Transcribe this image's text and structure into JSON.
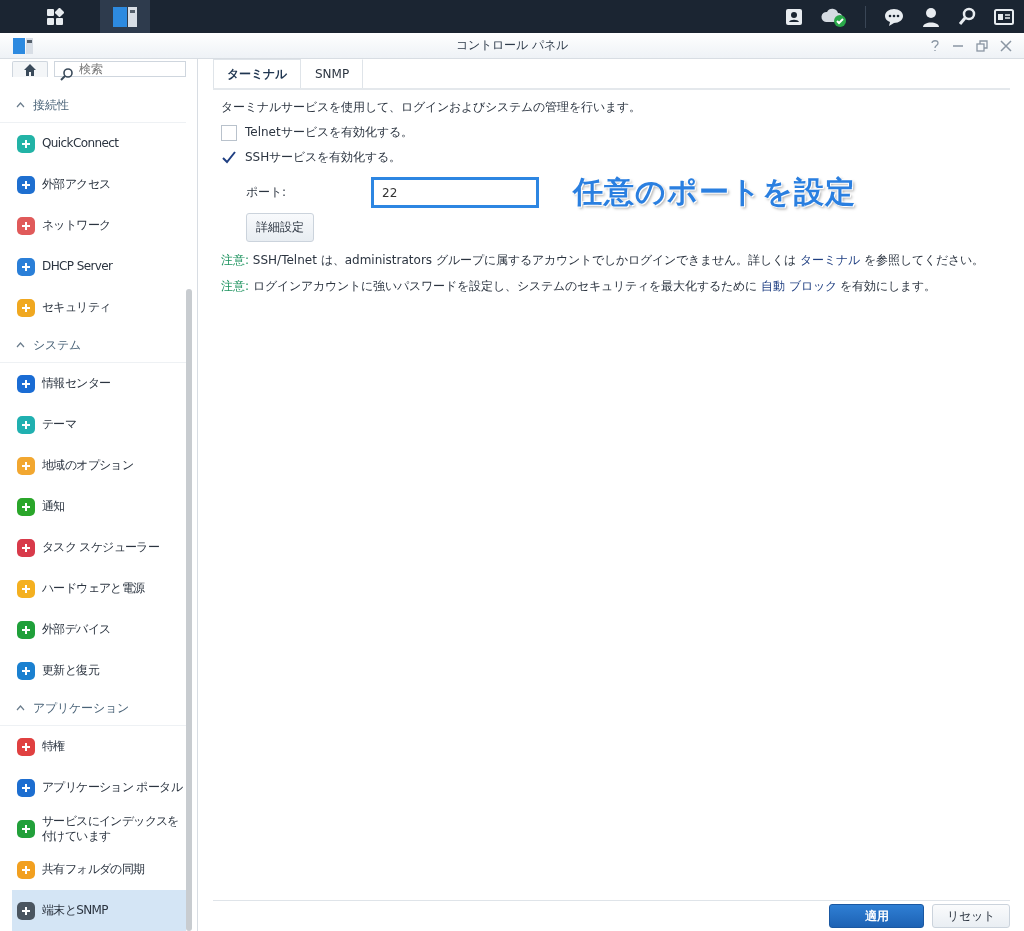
{
  "taskbar": {
    "apps": [
      {
        "selected": false
      },
      {
        "selected": true
      }
    ]
  },
  "window": {
    "title": "コントロール パネル"
  },
  "sidebar": {
    "search": {
      "placeholder": "検索"
    },
    "items": [
      {
        "kind": "section",
        "label": "接続性",
        "expanded": true
      },
      {
        "kind": "item",
        "label": "QuickConnect",
        "color": "#22b3a6",
        "selected": false
      },
      {
        "kind": "item",
        "label": "外部アクセス",
        "color": "#1e6fd0",
        "selected": false
      },
      {
        "kind": "item",
        "label": "ネットワーク",
        "color": "#e05a5a",
        "selected": false
      },
      {
        "kind": "item",
        "label": "DHCP Server",
        "color": "#2a7fd8",
        "selected": false
      },
      {
        "kind": "item",
        "label": "セキュリティ",
        "color": "#f0a820",
        "selected": false
      },
      {
        "kind": "section",
        "label": "システム",
        "expanded": true
      },
      {
        "kind": "item",
        "label": "情報センター",
        "color": "#1a6cd4",
        "selected": false
      },
      {
        "kind": "item",
        "label": "テーマ",
        "color": "#20b0b0",
        "selected": false
      },
      {
        "kind": "item",
        "label": "地域のオプション",
        "color": "#f2a730",
        "selected": false
      },
      {
        "kind": "item",
        "label": "通知",
        "color": "#2aa62a",
        "selected": false
      },
      {
        "kind": "item",
        "label": "タスク スケジューラー",
        "color": "#d83a4a",
        "selected": false
      },
      {
        "kind": "item",
        "label": "ハードウェアと電源",
        "color": "#f4b020",
        "selected": false
      },
      {
        "kind": "item",
        "label": "外部デバイス",
        "color": "#1fa03a",
        "selected": false
      },
      {
        "kind": "item",
        "label": "更新と復元",
        "color": "#1a80d0",
        "selected": false
      },
      {
        "kind": "section",
        "label": "アプリケーション",
        "expanded": true
      },
      {
        "kind": "item",
        "label": "特権",
        "color": "#e04040",
        "selected": false
      },
      {
        "kind": "item",
        "label": "アプリケーション ポータル",
        "color": "#1d6ed0",
        "selected": false
      },
      {
        "kind": "item",
        "label": "サービスにインデックスを付けています",
        "color": "#22a03a",
        "selected": false
      },
      {
        "kind": "item",
        "label": "共有フォルダの同期",
        "color": "#f2a020",
        "selected": false
      },
      {
        "kind": "item",
        "label": "端末とSNMP",
        "color": "#4a5560",
        "selected": true
      }
    ]
  },
  "tabs": [
    {
      "label": "ターミナル",
      "selected": true
    },
    {
      "label": "SNMP",
      "selected": false
    }
  ],
  "description": "ターミナルサービスを使用して、ログインおよびシステムの管理を行います。",
  "options": [
    {
      "label": "Telnetサービスを有効化する。",
      "checked": false
    },
    {
      "label": "SSHサービスを有効化する。",
      "checked": true
    }
  ],
  "port": {
    "label": "ポート:",
    "value": "22",
    "highlighted": true
  },
  "advanced_button": "詳細設定",
  "notes": [
    {
      "parts": [
        {
          "kind": "label",
          "text": "注意:"
        },
        {
          "kind": "text",
          "text": " SSH/Telnet は、administrators グループに属するアカウントでしかログインできません。詳しくは "
        },
        {
          "kind": "link",
          "text": "ターミナル"
        },
        {
          "kind": "text",
          "text": " を参照してください。"
        }
      ]
    },
    {
      "parts": [
        {
          "kind": "label",
          "text": "注意:"
        },
        {
          "kind": "text",
          "text": " ログインアカウントに強いパスワードを設定し、システムのセキュリティを最大化するために "
        },
        {
          "kind": "link",
          "text": "自動 ブロック"
        },
        {
          "kind": "text",
          "text": " を有効にします。"
        }
      ]
    }
  ],
  "annotation": "任意のポートを設定",
  "buttons": [
    {
      "label": "適用",
      "kind": "primary"
    },
    {
      "label": "リセット",
      "kind": "secondary"
    }
  ]
}
